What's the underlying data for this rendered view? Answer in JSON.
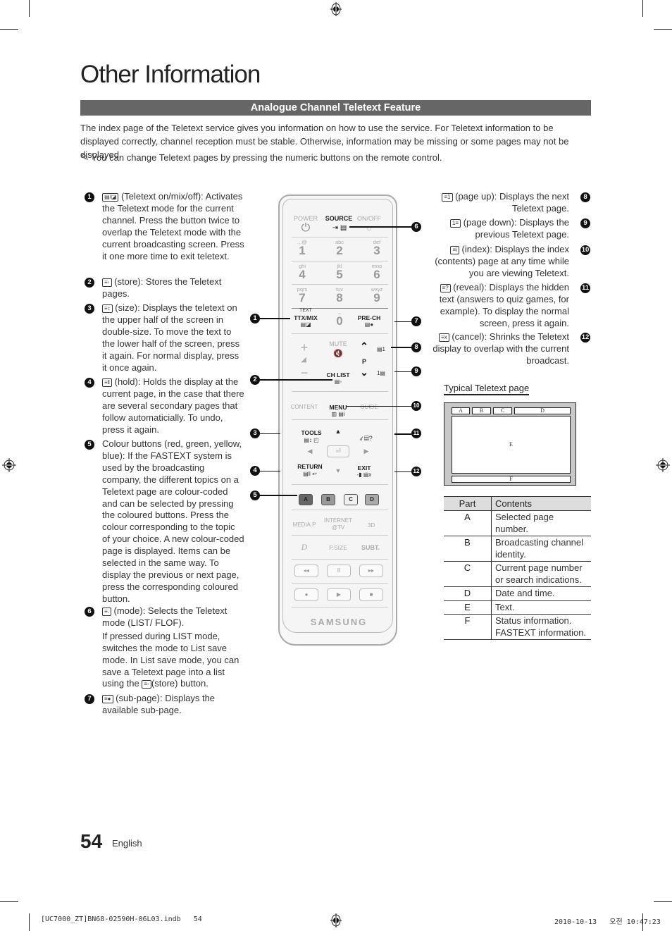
{
  "page": {
    "title": "Other Information",
    "section_heading": "Analogue Channel Teletext Feature",
    "intro": "The index page of the Teletext service gives you information on how to use the service. For Teletext information to be displayed correctly, channel reception must be stable. Otherwise, information may be missing or some pages may not be displayed.",
    "note_icon": "pencil-note-icon",
    "note": "You can change Teletext pages by pressing the numeric buttons on the remote control."
  },
  "left_items": [
    {
      "num": "1",
      "icon": "▤/◪",
      "text": "(Teletext on/mix/off): Activates the Teletext mode for the current channel.  Press the button twice to overlap the Teletext mode with the current broadcasting screen. Press it one more time to exit teletext."
    },
    {
      "num": "2",
      "icon": "≡◦",
      "text": "(store): Stores the Teletext pages."
    },
    {
      "num": "3",
      "icon": "≡↕",
      "text": "(size): Displays the teletext on the upper half of the screen in double-size. To move the text to the lower half of the screen, press it again. For normal display, press it once again."
    },
    {
      "num": "4",
      "icon": "≡‖",
      "text": "(hold): Holds the display at the current page, in the case that there are several secondary pages that follow automaticially. To undo, press it again."
    },
    {
      "num": "5",
      "icon": "",
      "text": "Colour buttons (red, green, yellow, blue): If the FASTEXT system is used by the broadcasting company, the different topics on a Teletext page are colour-coded and can be selected by pressing the coloured buttons. Press the colour corresponding to the topic of your choice. A new colour-coded page is displayed. Items can be selected in the same way. To display the previous or next page, press the corresponding coloured button."
    },
    {
      "num": "6",
      "icon": "≡.",
      "text": "(mode): Selects the Teletext mode (LIST/ FLOF).",
      "extra": "If pressed during LIST mode, switches the mode to List save mode. In List save mode, you can save a Teletext page into a list using the",
      "extra_icon": "≡◦",
      "extra_tail": "(store) button."
    },
    {
      "num": "7",
      "icon": "≡●",
      "text": "(sub-page): Displays the available sub-page."
    }
  ],
  "right_items": [
    {
      "num": "8",
      "icon": "≡1",
      "text": "(page up): Displays the next Teletext page."
    },
    {
      "num": "9",
      "icon": "1≡",
      "text": "(page down): Displays the previous Teletext page."
    },
    {
      "num": "10",
      "icon": "≡i",
      "text": "(index): Displays the index (contents) page at any time while you are viewing Teletext."
    },
    {
      "num": "11",
      "icon": "≡?",
      "text": "(reveal): Displays the hidden text (answers to quiz games, for example). To display the normal screen, press it again."
    },
    {
      "num": "12",
      "icon": "≡x",
      "text": "(cancel): Shrinks the Teletext display to overlap with the current broadcast."
    }
  ],
  "remote": {
    "power": "POWER",
    "source": "SOURCE",
    "onoff": "ON/OFF",
    "keys": [
      {
        "n": "1",
        "s": ".,:@"
      },
      {
        "n": "2",
        "s": "abc"
      },
      {
        "n": "3",
        "s": "def"
      },
      {
        "n": "4",
        "s": "ghi"
      },
      {
        "n": "5",
        "s": "jkl"
      },
      {
        "n": "6",
        "s": "mno"
      },
      {
        "n": "7",
        "s": "pqrs"
      },
      {
        "n": "8",
        "s": "tuv"
      },
      {
        "n": "9",
        "s": "wxyz"
      }
    ],
    "zero": "0",
    "text": "TEXT",
    "ttx": "TTX/MIX",
    "prech": "PRE-CH",
    "mute": "MUTE",
    "p": "P",
    "chlist": "CH LIST",
    "content": "CONTENT",
    "menu": "MENU",
    "guide": "GUIDE",
    "tools": "TOOLS",
    "return": "RETURN",
    "exit": "EXIT",
    "color_buttons": [
      "A",
      "B",
      "C",
      "D"
    ],
    "mediap": "MEDIA.P",
    "internet": "INTERNET",
    "internet2": "@TV",
    "three_d": "3D",
    "dolby": "D",
    "psize": "P.SIZE",
    "subt": "SUBT.",
    "transport_row1": [
      "◂◂",
      "II",
      "▸▸"
    ],
    "transport_row2": [
      "●",
      "▶",
      "■"
    ],
    "brand": "SAMSUNG"
  },
  "callouts_left": [
    "1",
    "2",
    "3",
    "4",
    "5"
  ],
  "callouts_right": [
    "6",
    "7",
    "8",
    "9",
    "10",
    "11",
    "12"
  ],
  "teletext_diagram": {
    "title": "Typical Teletext page",
    "labels": {
      "A": "A",
      "B": "B",
      "C": "C",
      "D": "D",
      "E": "E",
      "F": "F"
    }
  },
  "parts_table": {
    "headers": [
      "Part",
      "Contents"
    ],
    "rows": [
      [
        "A",
        "Selected page number."
      ],
      [
        "B",
        "Broadcasting channel identity."
      ],
      [
        "C",
        "Current page number or search indications."
      ],
      [
        "D",
        "Date and time."
      ],
      [
        "E",
        "Text."
      ],
      [
        "F",
        "Status information. FASTEXT information."
      ]
    ]
  },
  "footer": {
    "page_number": "54",
    "language": "English",
    "slug_left": "[UC7000_ZT]BN68-02590H-06L03.indb   54",
    "slug_right": "2010-10-13   오전 10:47:23"
  }
}
